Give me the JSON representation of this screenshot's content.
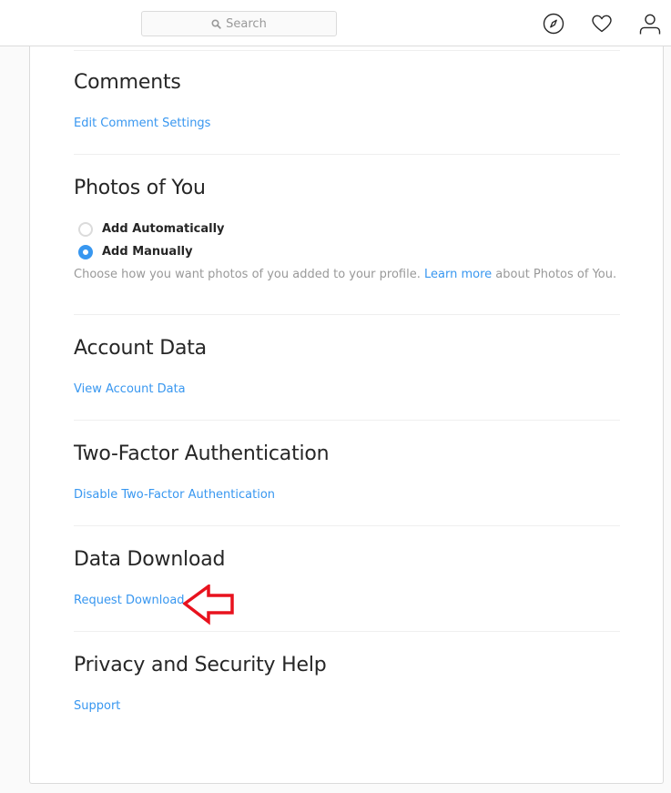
{
  "header": {
    "search_placeholder": "Search",
    "icons": [
      "compass-icon",
      "heart-icon",
      "person-icon"
    ]
  },
  "sections": {
    "comments": {
      "title": "Comments",
      "link": "Edit Comment Settings"
    },
    "photos_of_you": {
      "title": "Photos of You",
      "options": [
        {
          "label": "Add Automatically",
          "selected": false
        },
        {
          "label": "Add Manually",
          "selected": true
        }
      ],
      "help_before": "Choose how you want photos of you added to your profile.",
      "help_link": "Learn more",
      "help_after": "about Photos of You."
    },
    "account_data": {
      "title": "Account Data",
      "link": "View Account Data"
    },
    "two_factor": {
      "title": "Two-Factor Authentication",
      "link": "Disable Two-Factor Authentication"
    },
    "data_download": {
      "title": "Data Download",
      "link": "Request Download"
    },
    "help": {
      "title": "Privacy and Security Help",
      "link": "Support"
    }
  },
  "annotation": {
    "type": "arrow-left",
    "color": "#e8121e",
    "target": "Request Download"
  },
  "colors": {
    "link": "#3897f0",
    "text": "#262626",
    "muted": "#999999",
    "border": "#dbdbdb"
  }
}
